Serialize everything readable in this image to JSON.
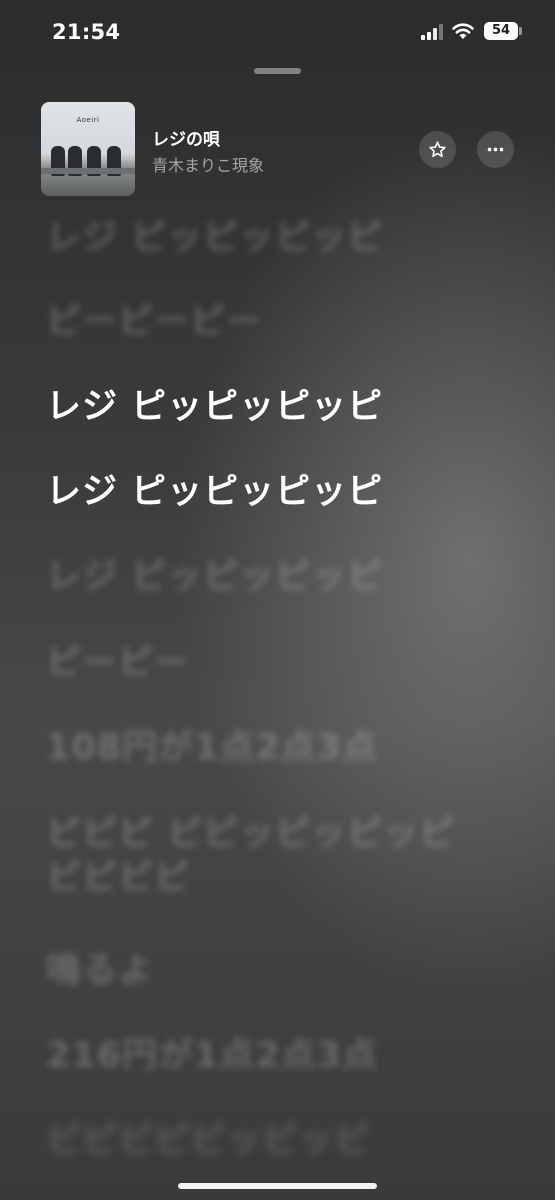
{
  "status": {
    "time": "21:54",
    "battery": "54"
  },
  "now_playing": {
    "title": "レジの唄",
    "artist": "青木まりこ現象",
    "artwork_text": "Aoeiri"
  },
  "lyrics": [
    {
      "text": "レジ ピッピッピッピ",
      "state": "past"
    },
    {
      "text": "ピーピーピー",
      "state": "past"
    },
    {
      "text": "レジ ピッピッピッピ",
      "state": "active"
    },
    {
      "text": "レジ ピッピッピッピ",
      "state": "active"
    },
    {
      "text": "レジ ピッピッピッピ",
      "state": "upcoming"
    },
    {
      "text": "ピーピー",
      "state": "upcoming"
    },
    {
      "text": "108円が1点2点3点",
      "state": "upcoming"
    },
    {
      "text": "ピピピ ピピッピッピッピ\nピピピピ",
      "state": "upcoming"
    },
    {
      "text": "鳴るよ",
      "state": "upcoming"
    },
    {
      "text": "216円が1点2点3点",
      "state": "upcoming"
    },
    {
      "text": "ピピピピピッピッピ",
      "state": "upcoming"
    }
  ],
  "icons": {
    "star": "star-icon",
    "more": "ellipsis-icon",
    "signal": "cellular-signal-icon",
    "wifi": "wifi-icon",
    "battery": "battery-icon"
  }
}
